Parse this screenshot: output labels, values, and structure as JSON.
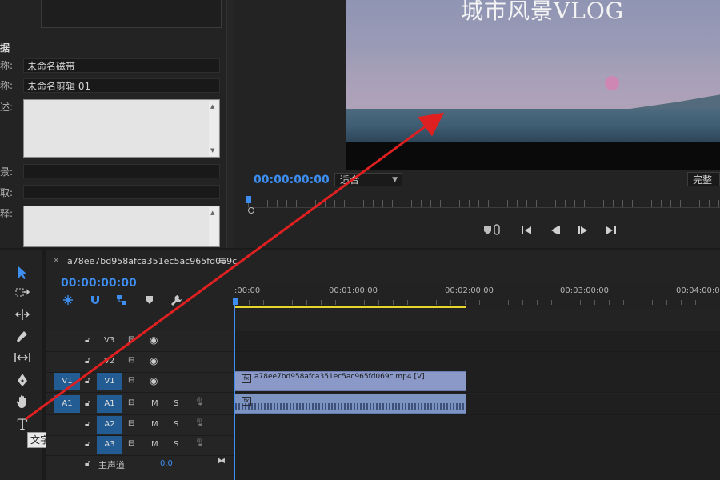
{
  "metadata": {
    "title": "据",
    "tape_label": "称:",
    "tape_value": "未命名磁带",
    "clip_label": "称:",
    "clip_value": "未命名剪辑 01",
    "desc_label": "述:",
    "scene_label": "景:",
    "take_label": "取:",
    "note_label": "释:"
  },
  "monitor": {
    "video_title": "城市风景VLOG",
    "timecode": "00:00:00:00",
    "fit_value": "适合",
    "quality_value": "完整",
    "controls": [
      "marker-in-icon",
      "step-back-frame-icon",
      "play-back-icon",
      "play-forward-icon",
      "step-forward-icon"
    ]
  },
  "tools": {
    "tooltip": "文字工具 (T)",
    "items": [
      "selection",
      "track-select",
      "ripple",
      "razor",
      "slip",
      "pen",
      "hand",
      "type"
    ]
  },
  "timeline": {
    "sequence_name": "a78ee7bd958afca351ec5ac965fd069c",
    "timecode": "00:00:00:00",
    "ruler_labels": [
      ":00:00",
      "00:01:00:00",
      "00:02:00:00",
      "00:03:00:00",
      "00:04:00:00"
    ],
    "tracks": {
      "v3": "V3",
      "v2": "V2",
      "v1": "V1",
      "v1_source": "V1",
      "a1": "A1",
      "a1_source": "A1",
      "a2": "A2",
      "a3": "A3",
      "m_label": "M",
      "s_label": "S",
      "master_label": "主声道",
      "master_value": "0.0"
    },
    "clip_video_label": "a78ee7bd958afca351ec5ac965fd069c.mp4 [V]",
    "fx_badge": "fx"
  },
  "colors": {
    "accent_blue": "#3d8ef0",
    "work_area": "#e6d62a",
    "clip_video": "#8a99c7",
    "annotation": "#e02020"
  }
}
